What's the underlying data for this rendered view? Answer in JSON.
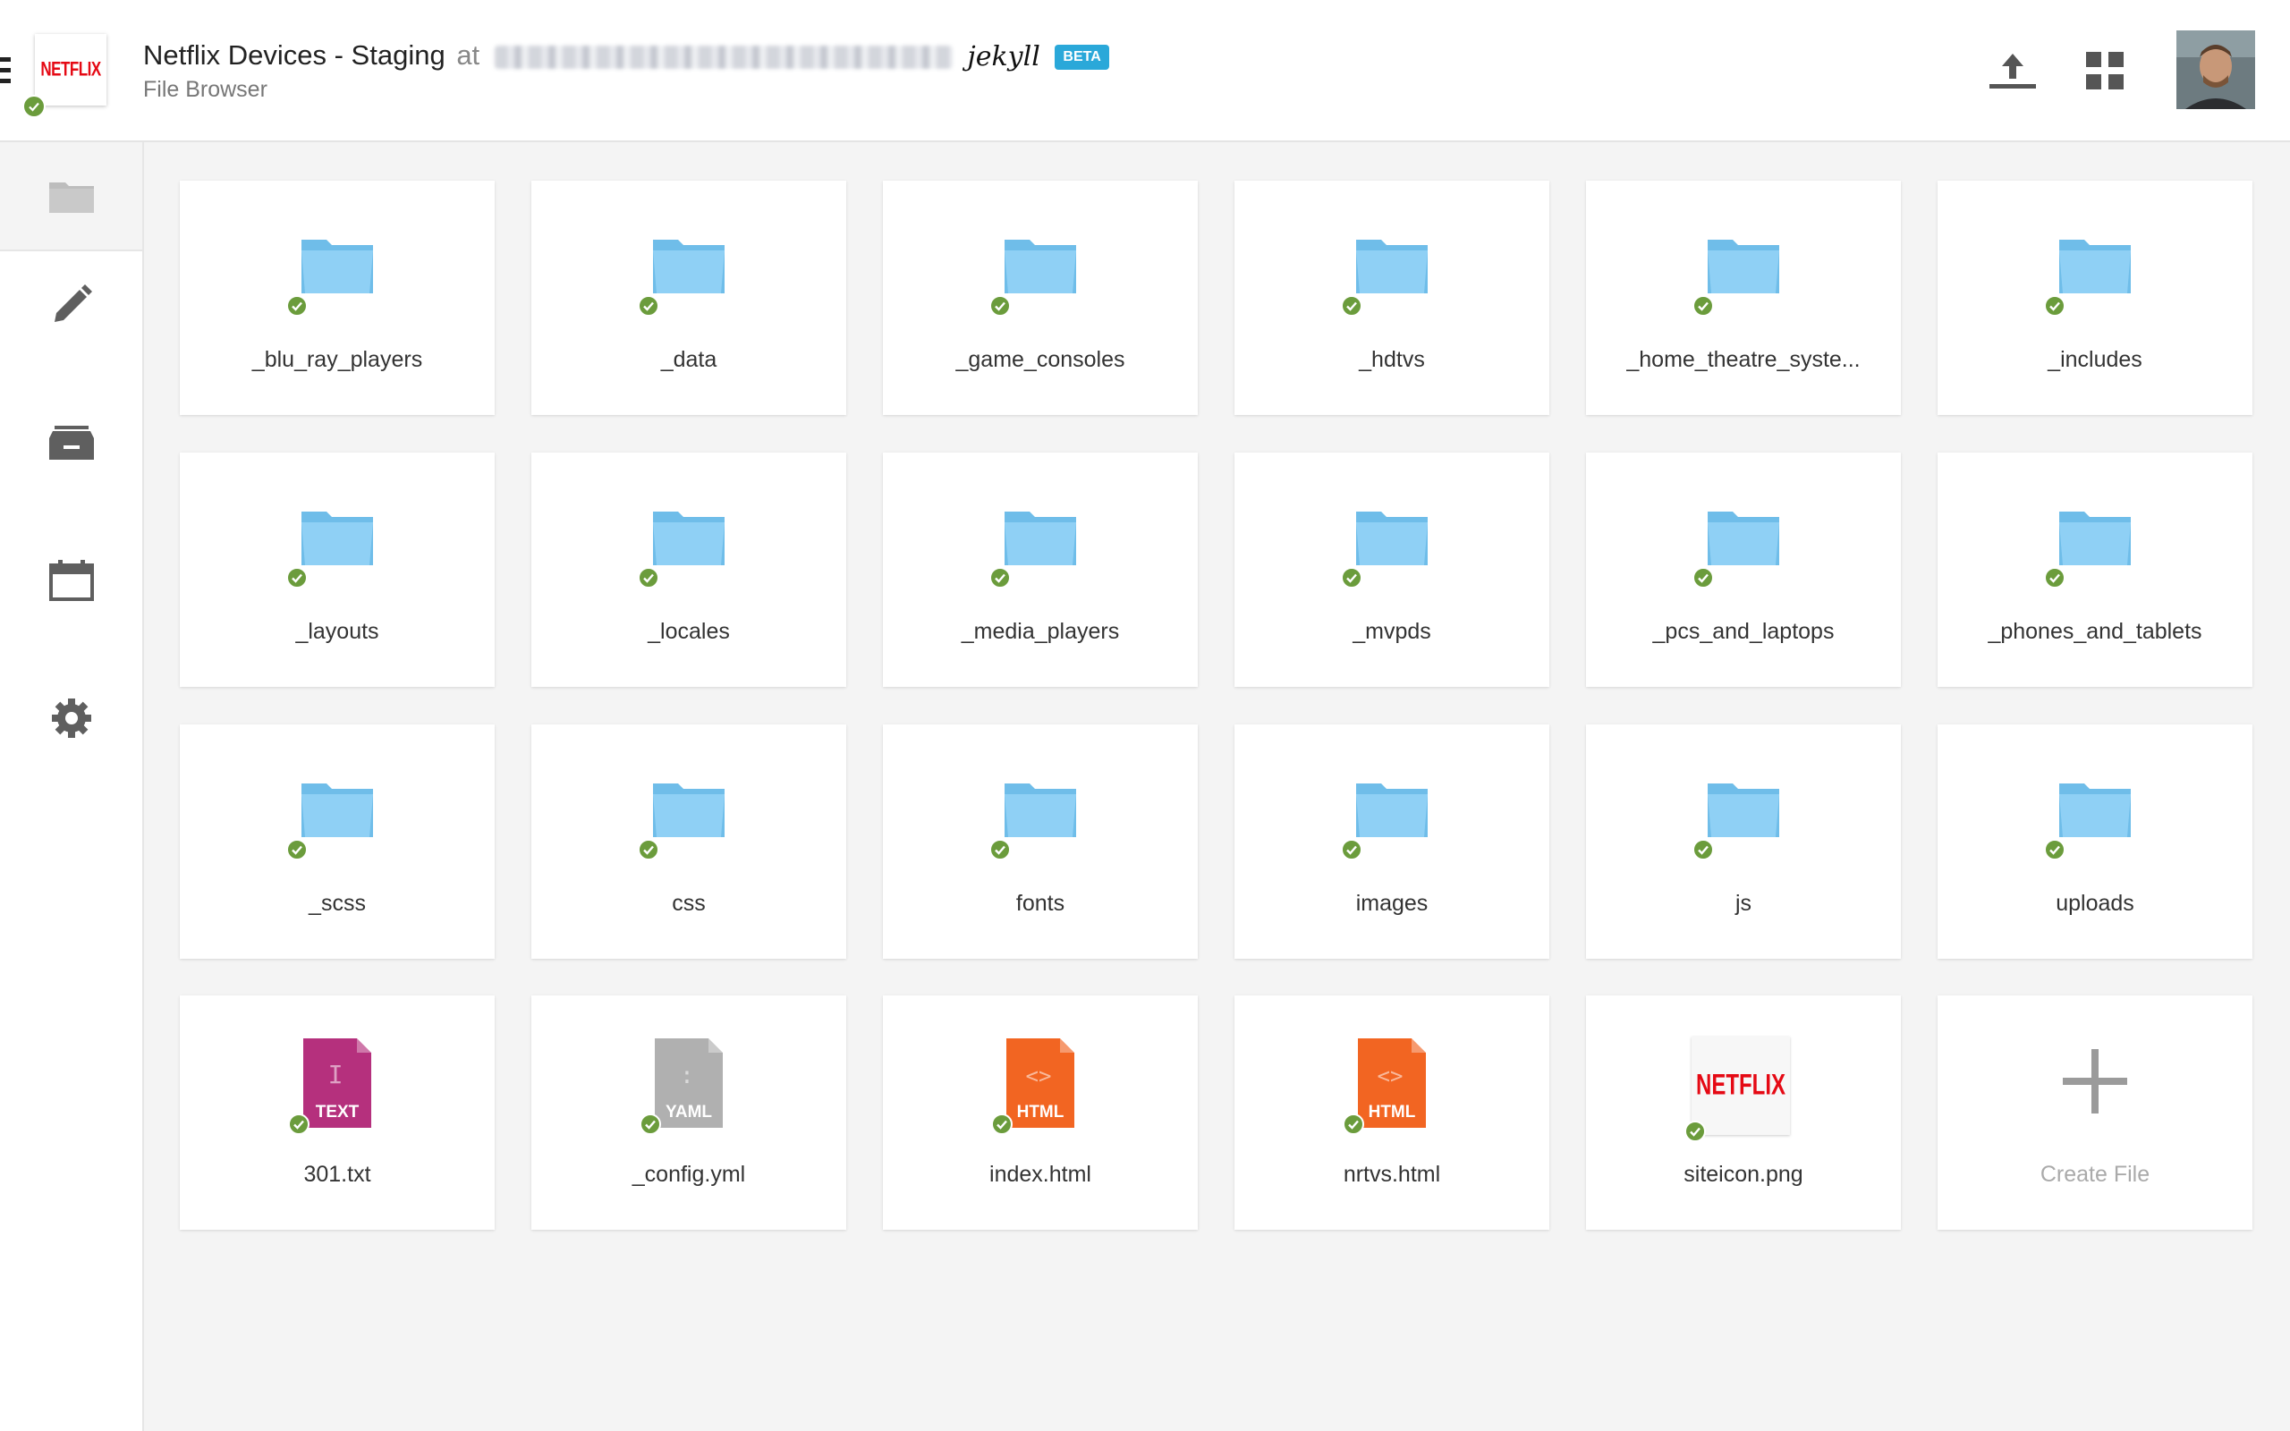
{
  "header": {
    "site_name": "Netflix Devices - Staging",
    "at_text": "at",
    "generator": "jekyll",
    "beta_badge": "BETA",
    "subtitle": "File Browser",
    "logo_text": "NETFLIX"
  },
  "sidebar": {
    "items": [
      {
        "name": "files",
        "icon": "folder-icon",
        "active": true
      },
      {
        "name": "edit",
        "icon": "pencil-icon"
      },
      {
        "name": "archive",
        "icon": "inbox-icon"
      },
      {
        "name": "calendar",
        "icon": "calendar-icon"
      },
      {
        "name": "settings",
        "icon": "gear-icon"
      }
    ]
  },
  "files": [
    {
      "name": "_blu_ray_players",
      "type": "folder"
    },
    {
      "name": "_data",
      "type": "folder"
    },
    {
      "name": "_game_consoles",
      "type": "folder"
    },
    {
      "name": "_hdtvs",
      "type": "folder"
    },
    {
      "name": "_home_theatre_syste...",
      "type": "folder"
    },
    {
      "name": "_includes",
      "type": "folder"
    },
    {
      "name": "_layouts",
      "type": "folder"
    },
    {
      "name": "_locales",
      "type": "folder"
    },
    {
      "name": "_media_players",
      "type": "folder"
    },
    {
      "name": "_mvpds",
      "type": "folder"
    },
    {
      "name": "_pcs_and_laptops",
      "type": "folder"
    },
    {
      "name": "_phones_and_tablets",
      "type": "folder"
    },
    {
      "name": "_scss",
      "type": "folder"
    },
    {
      "name": "css",
      "type": "folder"
    },
    {
      "name": "fonts",
      "type": "folder"
    },
    {
      "name": "images",
      "type": "folder"
    },
    {
      "name": "js",
      "type": "folder"
    },
    {
      "name": "uploads",
      "type": "folder"
    },
    {
      "name": "301.txt",
      "type": "text",
      "badge": "TEXT",
      "color": "#b5307d"
    },
    {
      "name": "_config.yml",
      "type": "yaml",
      "badge": "YAML",
      "color": "#b0b0b0"
    },
    {
      "name": "index.html",
      "type": "html",
      "badge": "HTML",
      "color": "#f26522"
    },
    {
      "name": "nrtvs.html",
      "type": "html",
      "badge": "HTML",
      "color": "#f26522"
    },
    {
      "name": "siteicon.png",
      "type": "image",
      "badge": "NETFLIX"
    }
  ],
  "create_file_label": "Create File",
  "colors": {
    "folder": "#8fd0f5",
    "check": "#6b9c3c",
    "beta": "#2aa8d9",
    "netflix_red": "#e50914"
  }
}
